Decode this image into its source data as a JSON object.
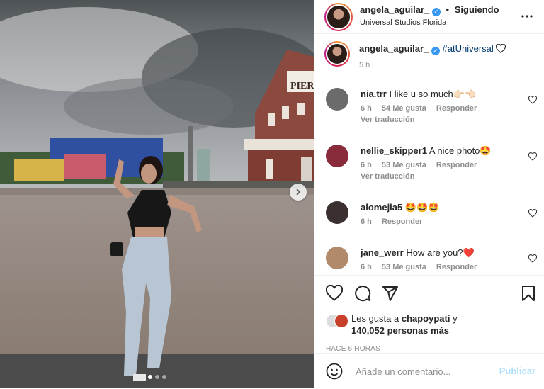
{
  "post": {
    "username": "angela_aguilar_",
    "follow_status": "Siguiendo",
    "location": "Universal Studios Florida",
    "caption_username": "angela_aguilar_",
    "caption_text": "#atUniversal",
    "caption_time": "5 h",
    "image_sign_text": "PIER",
    "photo_index": 1,
    "photo_count": 3
  },
  "comments": [
    {
      "username": "nia.trr",
      "text": "I like u so much👉🏻👈🏻",
      "time": "6 h",
      "likes": "54 Me gusta",
      "reply": "Responder",
      "translate": "Ver traducción",
      "avatar_color": "#6b6b6b"
    },
    {
      "username": "nellie_skipper1",
      "text": "A nice photo🤩",
      "time": "6 h",
      "likes": "53 Me gusta",
      "reply": "Responder",
      "translate": "Ver traducción",
      "avatar_color": "#8a2b3c"
    },
    {
      "username": "alomejia5",
      "text": "🤩🤩🤩",
      "time": "6 h",
      "likes": "",
      "reply": "Responder",
      "translate": "",
      "avatar_color": "#3b3030"
    },
    {
      "username": "jane_werr",
      "text": "How are you?❤️",
      "time": "6 h",
      "likes": "53 Me gusta",
      "reply": "Responder",
      "translate": "",
      "avatar_color": "#b08a6a"
    }
  ],
  "likes": {
    "prefix": "Les gusta a",
    "first_liker": "chapoypati",
    "conjunction": "y",
    "others": "140,052 personas más"
  },
  "timestamp": "HACE 6 HORAS",
  "composer": {
    "placeholder": "Añade un comentario...",
    "publish_label": "Publicar"
  },
  "colors": {
    "text_primary": "#262626",
    "text_secondary": "#8e8e8e",
    "link_blue": "#0095f6",
    "publish_disabled": "#b2dffc",
    "verified_blue": "#3897f0",
    "heart_red": "#ed4956"
  },
  "icons": {
    "menu": "more-horizontal-icon",
    "like": "heart-icon",
    "comment": "comment-icon",
    "share": "paper-plane-icon",
    "save": "bookmark-icon",
    "emoji": "smiley-icon",
    "next": "chevron-right-icon"
  }
}
